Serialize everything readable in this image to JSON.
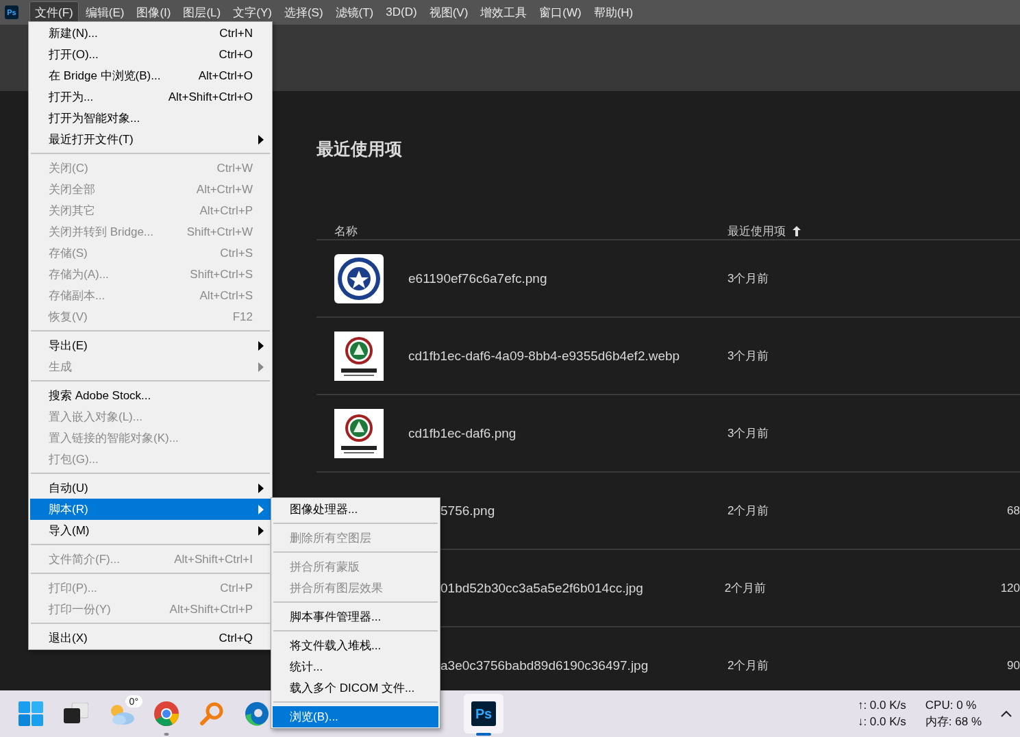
{
  "menubar": {
    "logo_text": "Ps",
    "items": [
      {
        "label": "文件(F)",
        "selected": true
      },
      {
        "label": "编辑(E)",
        "selected": false
      },
      {
        "label": "图像(I)",
        "selected": false
      },
      {
        "label": "图层(L)",
        "selected": false
      },
      {
        "label": "文字(Y)",
        "selected": false
      },
      {
        "label": "选择(S)",
        "selected": false
      },
      {
        "label": "滤镜(T)",
        "selected": false
      },
      {
        "label": "3D(D)",
        "selected": false
      },
      {
        "label": "视图(V)",
        "selected": false
      },
      {
        "label": "增效工具",
        "selected": false
      },
      {
        "label": "窗口(W)",
        "selected": false
      },
      {
        "label": "帮助(H)",
        "selected": false
      }
    ]
  },
  "file_menu": {
    "items": [
      {
        "kind": "item",
        "label": "新建(N)...",
        "shortcut": "Ctrl+N",
        "disabled": false,
        "selected": false,
        "submenu": false
      },
      {
        "kind": "item",
        "label": "打开(O)...",
        "shortcut": "Ctrl+O",
        "disabled": false,
        "selected": false,
        "submenu": false
      },
      {
        "kind": "item",
        "label": "在 Bridge 中浏览(B)...",
        "shortcut": "Alt+Ctrl+O",
        "disabled": false,
        "selected": false,
        "submenu": false
      },
      {
        "kind": "item",
        "label": "打开为...",
        "shortcut": "Alt+Shift+Ctrl+O",
        "disabled": false,
        "selected": false,
        "submenu": false
      },
      {
        "kind": "item",
        "label": "打开为智能对象...",
        "disabled": false,
        "selected": false,
        "submenu": false
      },
      {
        "kind": "item",
        "label": "最近打开文件(T)",
        "disabled": false,
        "selected": false,
        "submenu": true
      },
      {
        "kind": "separator"
      },
      {
        "kind": "item",
        "label": "关闭(C)",
        "shortcut": "Ctrl+W",
        "disabled": true,
        "selected": false,
        "submenu": false
      },
      {
        "kind": "item",
        "label": "关闭全部",
        "shortcut": "Alt+Ctrl+W",
        "disabled": true,
        "selected": false,
        "submenu": false
      },
      {
        "kind": "item",
        "label": "关闭其它",
        "shortcut": "Alt+Ctrl+P",
        "disabled": true,
        "selected": false,
        "submenu": false
      },
      {
        "kind": "item",
        "label": "关闭并转到 Bridge...",
        "shortcut": "Shift+Ctrl+W",
        "disabled": true,
        "selected": false,
        "submenu": false
      },
      {
        "kind": "item",
        "label": "存储(S)",
        "shortcut": "Ctrl+S",
        "disabled": true,
        "selected": false,
        "submenu": false
      },
      {
        "kind": "item",
        "label": "存储为(A)...",
        "shortcut": "Shift+Ctrl+S",
        "disabled": true,
        "selected": false,
        "submenu": false
      },
      {
        "kind": "item",
        "label": "存储副本...",
        "shortcut": "Alt+Ctrl+S",
        "disabled": true,
        "selected": false,
        "submenu": false
      },
      {
        "kind": "item",
        "label": "恢复(V)",
        "shortcut": "F12",
        "disabled": true,
        "selected": false,
        "submenu": false
      },
      {
        "kind": "separator"
      },
      {
        "kind": "item",
        "label": "导出(E)",
        "disabled": false,
        "selected": false,
        "submenu": true
      },
      {
        "kind": "item",
        "label": "生成",
        "disabled": true,
        "selected": false,
        "submenu": true
      },
      {
        "kind": "separator"
      },
      {
        "kind": "item",
        "label": "搜索 Adobe Stock...",
        "disabled": false,
        "selected": false,
        "submenu": false
      },
      {
        "kind": "item",
        "label": "置入嵌入对象(L)...",
        "disabled": true,
        "selected": false,
        "submenu": false
      },
      {
        "kind": "item",
        "label": "置入链接的智能对象(K)...",
        "disabled": true,
        "selected": false,
        "submenu": false
      },
      {
        "kind": "item",
        "label": "打包(G)...",
        "disabled": true,
        "selected": false,
        "submenu": false
      },
      {
        "kind": "separator"
      },
      {
        "kind": "item",
        "label": "自动(U)",
        "disabled": false,
        "selected": false,
        "submenu": true
      },
      {
        "kind": "item",
        "label": "脚本(R)",
        "disabled": false,
        "selected": true,
        "submenu": true
      },
      {
        "kind": "item",
        "label": "导入(M)",
        "disabled": false,
        "selected": false,
        "submenu": true
      },
      {
        "kind": "separator"
      },
      {
        "kind": "item",
        "label": "文件简介(F)...",
        "shortcut": "Alt+Shift+Ctrl+I",
        "disabled": true,
        "selected": false,
        "submenu": false
      },
      {
        "kind": "separator"
      },
      {
        "kind": "item",
        "label": "打印(P)...",
        "shortcut": "Ctrl+P",
        "disabled": true,
        "selected": false,
        "submenu": false
      },
      {
        "kind": "item",
        "label": "打印一份(Y)",
        "shortcut": "Alt+Shift+Ctrl+P",
        "disabled": true,
        "selected": false,
        "submenu": false
      },
      {
        "kind": "separator"
      },
      {
        "kind": "item",
        "label": "退出(X)",
        "shortcut": "Ctrl+Q",
        "disabled": false,
        "selected": false,
        "submenu": false
      }
    ]
  },
  "scripts_submenu": {
    "items": [
      {
        "kind": "item",
        "label": "图像处理器...",
        "disabled": false,
        "selected": false
      },
      {
        "kind": "separator"
      },
      {
        "kind": "item",
        "label": "删除所有空图层",
        "disabled": true,
        "selected": false
      },
      {
        "kind": "separator"
      },
      {
        "kind": "item",
        "label": "拼合所有蒙版",
        "disabled": true,
        "selected": false
      },
      {
        "kind": "item",
        "label": "拼合所有图层效果",
        "disabled": true,
        "selected": false
      },
      {
        "kind": "separator"
      },
      {
        "kind": "item",
        "label": "脚本事件管理器...",
        "disabled": false,
        "selected": false
      },
      {
        "kind": "separator"
      },
      {
        "kind": "item",
        "label": "将文件载入堆栈...",
        "disabled": false,
        "selected": false
      },
      {
        "kind": "item",
        "label": "统计...",
        "disabled": false,
        "selected": false
      },
      {
        "kind": "item",
        "label": "载入多个 DICOM 文件...",
        "disabled": false,
        "selected": false
      },
      {
        "kind": "separator"
      },
      {
        "kind": "item",
        "label": "浏览(B)...",
        "disabled": false,
        "selected": true
      }
    ]
  },
  "recent": {
    "title": "最近使用项",
    "columns": [
      {
        "label": "名称"
      },
      {
        "label": "最近使用项",
        "sort_ascending": true
      }
    ],
    "rows": [
      {
        "name": "e61190ef76c6a7efc.png",
        "modified": "3个月前"
      },
      {
        "name": "cd1fb1ec-daf6-4a09-8bb4-e9355d6b4ef2.webp",
        "modified": "3个月前"
      },
      {
        "name": "cd1fb1ec-daf6.png",
        "modified": "3个月前"
      },
      {
        "name": "5756.png",
        "modified": "2个月前",
        "size": "68"
      },
      {
        "name": "01bd52b30cc3a5a5e2f6b014cc.jpg",
        "modified": "2个月前",
        "size": "120"
      },
      {
        "name": "a3e0c3756babd89d6190c36497.jpg",
        "modified": "2个月前",
        "size": "90"
      }
    ]
  },
  "taskbar": {
    "apps": [
      {
        "kind": "start",
        "running": false,
        "selected": false
      },
      {
        "kind": "task-view",
        "running": false,
        "selected": false
      },
      {
        "kind": "weather",
        "badge": "0°",
        "running": false,
        "selected": false
      },
      {
        "kind": "chrome",
        "running": true,
        "selected": false
      },
      {
        "kind": "magnifier",
        "running": false,
        "selected": false
      },
      {
        "kind": "edge",
        "running": false,
        "selected": false
      },
      {
        "kind": "photoshop",
        "logo_text": "Ps",
        "running": true,
        "selected": true
      }
    ],
    "upload": "↑: 0.0 K/s",
    "download": "↓: 0.0 K/s",
    "cpu": "CPU: 0 %",
    "memory": "内存: 68 %"
  }
}
